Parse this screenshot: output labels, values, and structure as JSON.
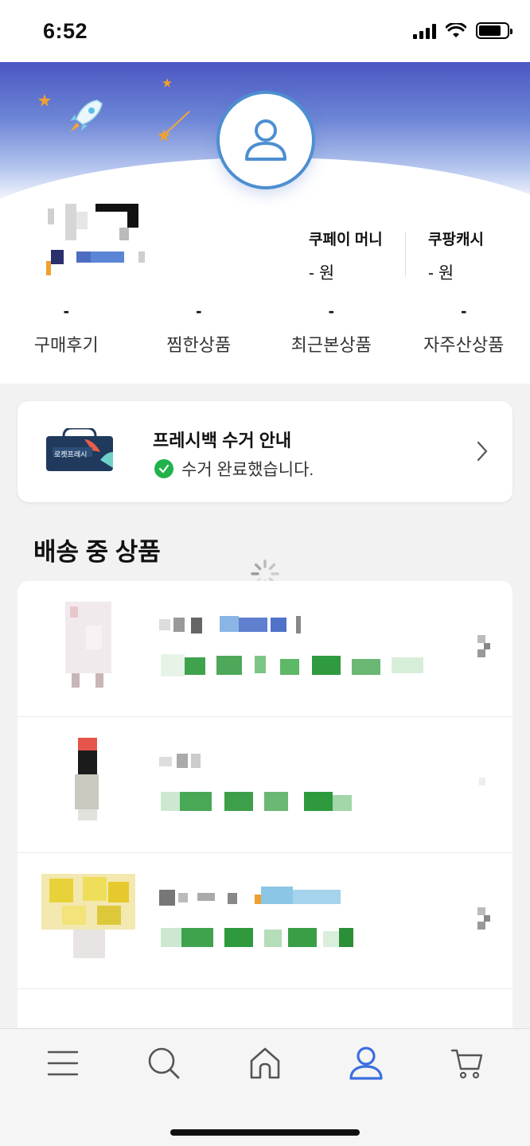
{
  "status_bar": {
    "time": "6:52",
    "battery_level": 0.8
  },
  "wallet": [
    {
      "label": "쿠페이 머니",
      "value": "- 원"
    },
    {
      "label": "쿠팡캐시",
      "value": "- 원"
    }
  ],
  "stats": [
    {
      "count": "-",
      "label": "구매후기"
    },
    {
      "count": "-",
      "label": "찜한상품"
    },
    {
      "count": "-",
      "label": "최근본상품"
    },
    {
      "count": "-",
      "label": "자주산상품"
    }
  ],
  "fresh_bag": {
    "title": "프레시백 수거 안내",
    "status": "수거 완료했습니다.",
    "bag_text": "로켓프레시"
  },
  "delivery": {
    "section_title": "배송 중 상품"
  },
  "nav": [
    "menu-icon",
    "search-icon",
    "home-icon",
    "user-icon",
    "cart-icon"
  ],
  "colors": {
    "accent": "#3a6fe0",
    "success": "#21b24b",
    "ring": "#4d8fd1"
  }
}
